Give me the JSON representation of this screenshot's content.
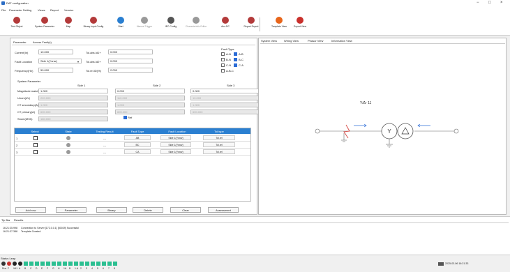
{
  "window": {
    "title": "DAT configuration",
    "minimize": "−",
    "maximize": "□",
    "close": "×"
  },
  "menu": [
    "File",
    "Parameter Setting",
    "Views",
    "Report",
    "Version"
  ],
  "toolbar": [
    {
      "label": "Test Object",
      "icon": "test-object-icon",
      "color": "#b33a3a",
      "enabled": true
    },
    {
      "label": "System Parameter",
      "icon": "system-parameter-icon",
      "color": "#b33a3a",
      "enabled": true
    },
    {
      "label": "Map",
      "icon": "map-icon",
      "color": "#b33a3a",
      "enabled": true
    },
    {
      "label": "Binary input Config",
      "icon": "binary-input-icon",
      "color": "#b33a3a",
      "enabled": true
    },
    {
      "label": "Start",
      "icon": "start-icon",
      "color": "#2a7fd1",
      "enabled": true
    },
    {
      "label": "Manual Trigger",
      "icon": "manual-trigger-icon",
      "color": "#999999",
      "enabled": false
    },
    {
      "label": "IEC Config",
      "icon": "iec-config-icon",
      "color": "#555555",
      "enabled": true
    },
    {
      "label": "Characteristic Editor",
      "icon": "characteristic-icon",
      "color": "#999999",
      "enabled": false
    },
    {
      "label": "Aux-DC",
      "icon": "aux-dc-icon",
      "color": "#b33a3a",
      "enabled": true
    },
    {
      "label": "Report Export",
      "icon": "report-export-icon",
      "color": "#b33a3a",
      "enabled": true
    },
    {
      "label": "Template View",
      "icon": "template-view-icon",
      "color": "#e8651a",
      "enabled": true
    },
    {
      "label": "Export View",
      "icon": "export-view-icon",
      "color": "#c9302c",
      "enabled": true
    }
  ],
  "left": {
    "tabs": [
      "Parameter",
      "Across Fault(s)"
    ],
    "current_label": "Current(In)",
    "current_value": "10.000",
    "fault_location_label": "Fault Location",
    "fault_location_value": "Side 1(Ysnw)",
    "frequency_label": "Frequency(Hz)",
    "frequency_value": "50.000",
    "tol_abs1_label": "Tol.abs.Id1+",
    "tol_abs1_value": "0.000",
    "tol_abs2_label": "Tol.abs.Id2+",
    "tol_abs2_value": "0.000",
    "tol_rel_label": "Tol.rel.ID(%)",
    "tol_rel_value": "2.000",
    "fault_type_label": "Fault Type",
    "fault_types": [
      {
        "label": "A-N",
        "checked": false
      },
      {
        "label": "A-B",
        "checked": true
      },
      {
        "label": "B-N",
        "checked": false
      },
      {
        "label": "B-C",
        "checked": true
      },
      {
        "label": "C-N",
        "checked": false
      },
      {
        "label": "C-A",
        "checked": true
      },
      {
        "label": "A-B-C",
        "checked": false
      }
    ],
    "system_param_label": "System Parameter",
    "sides": [
      "Side 1",
      "Side 2",
      "Side 3"
    ],
    "rows": [
      {
        "label": "Magnitude matching",
        "v1": "1.000",
        "v2": "0.000",
        "v3": "0.000",
        "gray": false
      },
      {
        "label": "Unom(kV)",
        "v1": "220.000",
        "v2": "110.000",
        "v3": "10.000",
        "gray": true
      },
      {
        "label": "CT secondary(A)",
        "v1": "1.000",
        "v2": "1.000",
        "v3": "1.000",
        "gray": true
      },
      {
        "label": "CT primary(A)",
        "v1": "600.000",
        "v2": "600.000",
        "v3": "600.000",
        "gray": true
      },
      {
        "label": "Snom(MVA)",
        "v1": "180.000",
        "v2": "",
        "v3": "",
        "gray": true
      }
    ],
    "ref_label": "Ref",
    "grid_headers": [
      "Select",
      "State",
      "Testing Result",
      "Fault Type",
      "Fault Location",
      "Tol.type"
    ],
    "grid_rows": [
      {
        "n": "1",
        "result": "---",
        "fault_type": "AB",
        "location": "Side 1(Ysnw)",
        "tol": "Tol.rel"
      },
      {
        "n": "2",
        "result": "---",
        "fault_type": "BC",
        "location": "Side 1(Ysnw)",
        "tol": "Tol.rel"
      },
      {
        "n": "3",
        "result": "---",
        "fault_type": "CA",
        "location": "Side 1(Ysnw)",
        "tol": "Tol.rel"
      }
    ],
    "buttons": [
      "Add row",
      "Parameter",
      "Binary",
      "Delete",
      "Clear",
      "Assessment"
    ]
  },
  "right": {
    "tabs": [
      "System View",
      "Wiring View",
      "Phasor View",
      "Information View"
    ],
    "vector_group": "Y/Δ- 11"
  },
  "log": {
    "tabs": [
      "Tip Bar",
      "Results"
    ],
    "lines": [
      {
        "time": "16:21:35.998",
        "msg": "Connection to Server [172.0.0.1] [50039] Successful"
      },
      {
        "time": "16:21:37.388",
        "msg": "Template Created"
      }
    ]
  },
  "status": {
    "label": "Status Leap",
    "led_labels": [
      "Run",
      "F",
      "VA1",
      "A",
      "B",
      "C",
      "D",
      "E",
      "F",
      "G",
      "H",
      "1A",
      "B",
      "1.A",
      "2",
      "3",
      "4",
      "5",
      "6",
      "7",
      "8"
    ],
    "datetime": "2025-03-06 16:21:33"
  }
}
